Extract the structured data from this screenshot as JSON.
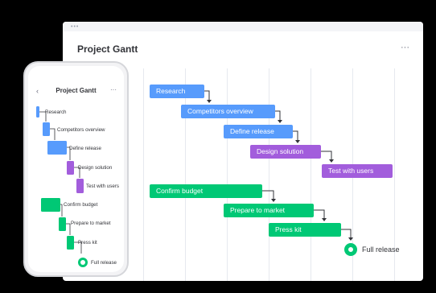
{
  "colors": {
    "blue": "#579bfc",
    "purple": "#a25ddc",
    "green": "#00c875",
    "text": "#323338"
  },
  "desktop": {
    "window_dots": "•••",
    "title": "Project Gantt",
    "more_icon": "···",
    "tasks": [
      {
        "label": "Research",
        "color": "blue"
      },
      {
        "label": "Competitors overview",
        "color": "blue"
      },
      {
        "label": "Define release",
        "color": "blue"
      },
      {
        "label": "Design solution",
        "color": "purple"
      },
      {
        "label": "Test with users",
        "color": "purple"
      },
      {
        "label": "Confirm budget",
        "color": "green"
      },
      {
        "label": "Prepare to market",
        "color": "green"
      },
      {
        "label": "Press kit",
        "color": "green"
      }
    ],
    "milestone": {
      "label": "Full release",
      "color": "green"
    }
  },
  "phone": {
    "back_icon": "‹",
    "title": "Project Gantt",
    "more_icon": "···",
    "tasks": [
      {
        "label": "Research",
        "color": "blue"
      },
      {
        "label": "Competitors overview",
        "color": "blue"
      },
      {
        "label": "Define release",
        "color": "blue"
      },
      {
        "label": "Design solution",
        "color": "purple"
      },
      {
        "label": "Test with users",
        "color": "purple"
      },
      {
        "label": "Confirm budget",
        "color": "green"
      },
      {
        "label": "Prepare to market",
        "color": "green"
      },
      {
        "label": "Press kit",
        "color": "green"
      }
    ],
    "milestone": {
      "label": "Full release",
      "color": "green"
    }
  }
}
